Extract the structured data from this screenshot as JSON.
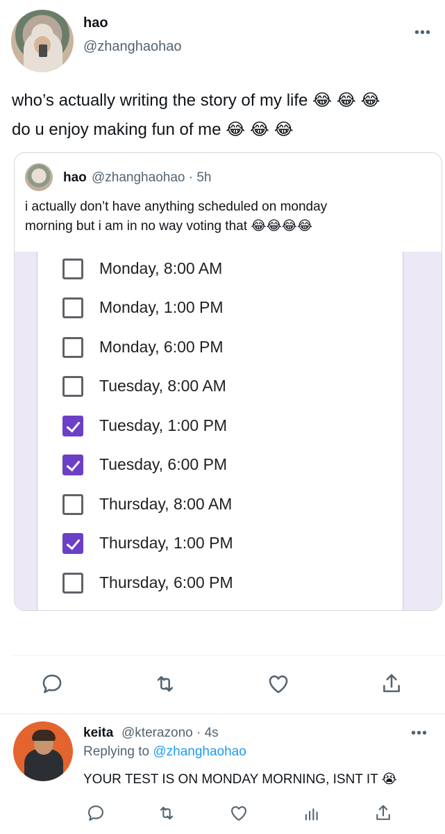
{
  "tweet": {
    "author_name": "hao",
    "author_handle": "@zhanghaohao",
    "more_label": "•••",
    "text_line1": "who’s actually writing the story of my life 😂 😂 😂",
    "text_line2": "do u enjoy making fun of me 😂 😂 😂"
  },
  "quoted": {
    "author_name": "hao",
    "handle_time": "@zhanghaohao · 5h",
    "text_line1": "i actually don’t have anything scheduled on monday",
    "text_line2": "morning but i am in no way voting that 😂😂😂😂"
  },
  "poll_options": [
    {
      "label": "Monday, 8:00 AM",
      "checked": false
    },
    {
      "label": "Monday, 1:00 PM",
      "checked": false
    },
    {
      "label": "Monday, 6:00 PM",
      "checked": false
    },
    {
      "label": "Tuesday, 8:00 AM",
      "checked": false
    },
    {
      "label": "Tuesday, 1:00 PM",
      "checked": true
    },
    {
      "label": "Tuesday, 6:00 PM",
      "checked": true
    },
    {
      "label": "Thursday, 8:00 AM",
      "checked": false
    },
    {
      "label": "Thursday, 1:00 PM",
      "checked": true
    },
    {
      "label": "Thursday, 6:00 PM",
      "checked": false
    }
  ],
  "actions": {
    "icons": [
      "reply-icon",
      "retweet-icon",
      "like-icon",
      "share-icon"
    ]
  },
  "reply": {
    "author_name": "keita",
    "handle_time": "@kterazono · 4s",
    "replying_prefix": "Replying to ",
    "replying_to": "@zhanghaohao",
    "text": "YOUR TEST IS ON MONDAY MORNING, ISNT IT 😭",
    "more_label": "•••",
    "icons": [
      "reply-icon",
      "retweet-icon",
      "like-icon",
      "analytics-icon",
      "share-icon"
    ]
  },
  "colors": {
    "accent_purple": "#6b3fc6",
    "link_blue": "#1d9bf0",
    "muted_gray": "#536471"
  }
}
